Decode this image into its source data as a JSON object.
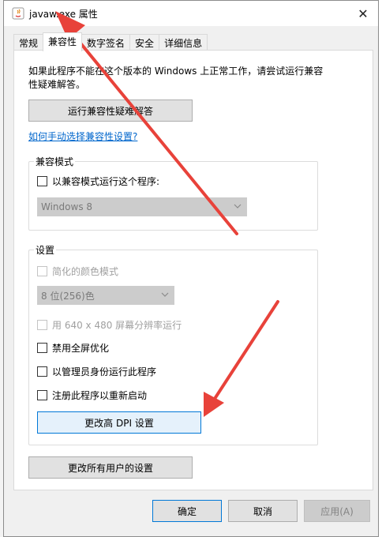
{
  "window": {
    "title": "javaw.exe 属性",
    "close_glyph": "✕"
  },
  "tabs": [
    {
      "label": "常规"
    },
    {
      "label": "兼容性"
    },
    {
      "label": "数字签名"
    },
    {
      "label": "安全"
    },
    {
      "label": "详细信息"
    }
  ],
  "compat": {
    "intro": "如果此程序不能在这个版本的 Windows 上正常工作，请尝试运行兼容性疑难解答。",
    "troubleshoot_button": "运行兼容性疑难解答",
    "manual_link": "如何手动选择兼容性设置?",
    "mode_group": {
      "title": "兼容模式",
      "checkbox_label": "以兼容模式运行这个程序:",
      "os_select": "Windows 8"
    },
    "settings_group": {
      "title": "设置",
      "reduced_color": "简化的颜色模式",
      "color_select": "8 位(256)色",
      "resolution": "用 640 x 480 屏幕分辨率运行",
      "fullscreen_opt": "禁用全屏优化",
      "run_as_admin": "以管理员身份运行此程序",
      "register_restart": "注册此程序以重新启动",
      "dpi_button": "更改高 DPI 设置"
    },
    "all_users_button": "更改所有用户的设置"
  },
  "footer": {
    "ok": "确定",
    "cancel": "取消",
    "apply": "应用(A)"
  },
  "colors": {
    "annotation_arrow": "#e8423a",
    "link": "#0066cc",
    "focus_border": "#0078d7"
  }
}
